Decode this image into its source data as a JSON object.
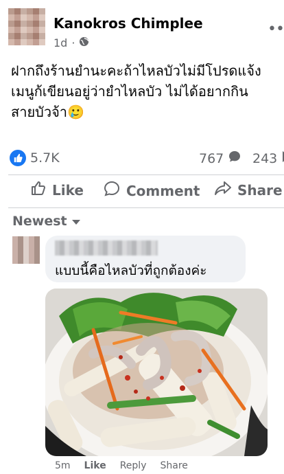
{
  "post": {
    "author": "Kanokros Chimplee",
    "time": "1d",
    "text_lines": [
      "ฝากถึงร้านยำนะคะถ้าไหลบัวไม่มีโปรดแจ้ง",
      "เมนูก้เขียนอยู่ว่ายำไหลบัว ไม่ได้อยากกิน",
      "สายบัวจ้า🥲"
    ]
  },
  "stats": {
    "reactions": "5.7K",
    "comments": "767",
    "shares": "243"
  },
  "actions": {
    "like": "Like",
    "comment": "Comment",
    "share": "Share"
  },
  "sort_label": "Newest",
  "comment": {
    "text": "แบบนี้คือไหลบัวที่ถูกต้องค่ะ",
    "time": "5m",
    "like": "Like",
    "reply": "Reply",
    "share": "Share"
  },
  "icons": [
    "globe-icon",
    "more-icon",
    "like-reaction-icon",
    "comment-count-icon",
    "share-count-icon",
    "like-icon",
    "comment-icon",
    "share-icon",
    "chevron-down-icon"
  ],
  "colors": {
    "accent": "#1877f2",
    "muted": "#65676b",
    "bubble": "#f0f2f5"
  }
}
